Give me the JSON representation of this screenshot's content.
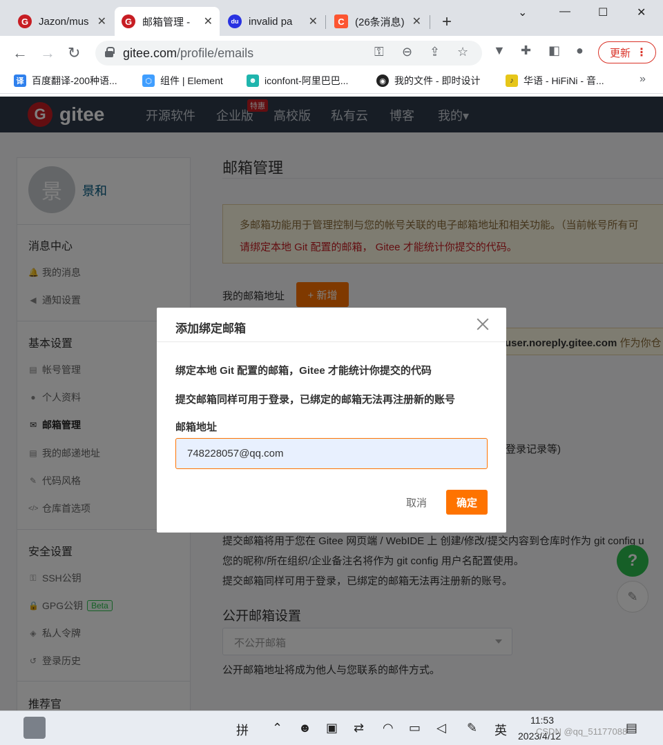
{
  "browser": {
    "tabs": [
      {
        "title": "Jazon/mus",
        "favicon_color": "#c71d23",
        "favicon": "G"
      },
      {
        "title": "邮箱管理 -",
        "favicon_color": "#c71d23",
        "favicon": "G"
      },
      {
        "title": "invalid pa",
        "favicon_color": "#2932e1",
        "favicon": "du"
      },
      {
        "title": "(26条消息)",
        "favicon_color": "#fc5531",
        "favicon": "C"
      }
    ],
    "new_tab": "+",
    "address": {
      "host": "gitee.com",
      "path": "/profile/emails"
    },
    "update_label": "更新",
    "bookmarks": [
      {
        "label": "百度翻译-200种语...",
        "icon_color": "#2f80ed",
        "icon_text": "译"
      },
      {
        "label": "组件 | Element",
        "icon_color": "#409eff",
        "icon_text": "⬡"
      },
      {
        "label": "iconfont-阿里巴巴...",
        "icon_color": "#1fb5ad",
        "icon_text": "☻"
      },
      {
        "label": "我的文件 - 即时设计",
        "icon_color": "#222222",
        "icon_text": "◉"
      },
      {
        "label": "华语 - HiFiNi - 音...",
        "icon_color": "#e6c619",
        "icon_text": "♪"
      }
    ],
    "bookmarks_more": "»"
  },
  "gitee": {
    "logo": "gitee",
    "nav": [
      "开源软件",
      "企业版",
      "高校版",
      "私有云",
      "博客",
      "我的▾"
    ],
    "nav_badge": "特惠"
  },
  "sidebar": {
    "avatar_char": "景",
    "user_name": "景和",
    "groups": [
      {
        "title": "消息中心",
        "items": [
          {
            "label": "我的消息",
            "icon": "bell-icon",
            "glyph": "🔔"
          },
          {
            "label": "通知设置",
            "icon": "speaker-icon",
            "glyph": "◀"
          }
        ]
      },
      {
        "title": "基本设置",
        "items": [
          {
            "label": "帐号管理",
            "icon": "id-card-icon",
            "glyph": "▤"
          },
          {
            "label": "个人资料",
            "icon": "user-icon",
            "glyph": "●"
          },
          {
            "label": "邮箱管理",
            "icon": "mail-icon",
            "glyph": "✉"
          },
          {
            "label": "我的邮递地址",
            "icon": "address-card-icon",
            "glyph": "▤"
          },
          {
            "label": "代码风格",
            "icon": "brush-icon",
            "glyph": "✎"
          },
          {
            "label": "仓库首选项",
            "icon": "code-icon",
            "glyph": "</>"
          }
        ]
      },
      {
        "title": "安全设置",
        "items": [
          {
            "label": "SSH公钥",
            "icon": "key-icon",
            "glyph": "⚿"
          },
          {
            "label": "GPG公钥",
            "icon": "lock-icon",
            "glyph": "🔒",
            "badge": "Beta"
          },
          {
            "label": "私人令牌",
            "icon": "token-icon",
            "glyph": "◈"
          },
          {
            "label": "登录历史",
            "icon": "history-icon",
            "glyph": "↺"
          }
        ]
      },
      {
        "title": "推荐官",
        "items": []
      }
    ]
  },
  "main": {
    "title": "邮箱管理",
    "notice_line1": "多邮箱功能用于管理控制与您的帐号关联的电子邮箱地址和相关功能。（当前帐号所有可",
    "notice_line2": "请绑定本地 Git 配置的邮箱， Gitee 才能统计你提交的代码。",
    "my_email_label": "我的邮箱地址",
    "add_button": "+ 新增",
    "noreply_email": "user.noreply.gitee.com",
    "noreply_tail": " 作为你仓",
    "login_records": "登录记录等)",
    "commit_lines": [
      "提交邮箱将用于您在 Gitee 网页端 / WebIDE 上 创建/修改/提交内容到仓库时作为 git config u",
      "您的昵称/所在组织/企业备注名将作为 git config 用户名配置使用。",
      "提交邮箱同样可用于登录，已绑定的邮箱无法再注册新的账号。"
    ],
    "public_title": "公开邮箱设置",
    "public_select": "不公开邮箱",
    "public_desc": "公开邮箱地址将成为他人与您联系的邮件方式。"
  },
  "modal": {
    "title": "添加绑定邮箱",
    "line1": "绑定本地 Git 配置的邮箱，Gitee 才能统计你提交的代码",
    "line2": "提交邮箱同样可用于登录，已绑定的邮箱无法再注册新的账号",
    "field_label": "邮箱地址",
    "email_value": "748228057@qq.com",
    "cancel": "取消",
    "confirm": "确定"
  },
  "taskbar": {
    "ime_mode": "拼",
    "lang": "英",
    "time": "11:53",
    "date": "2023/4/12",
    "watermark": "CSDN @qq_51177088"
  },
  "colors": {
    "brand": "#c71d23",
    "accent": "#fe7300",
    "nav_bg": "#2f3a4a"
  }
}
